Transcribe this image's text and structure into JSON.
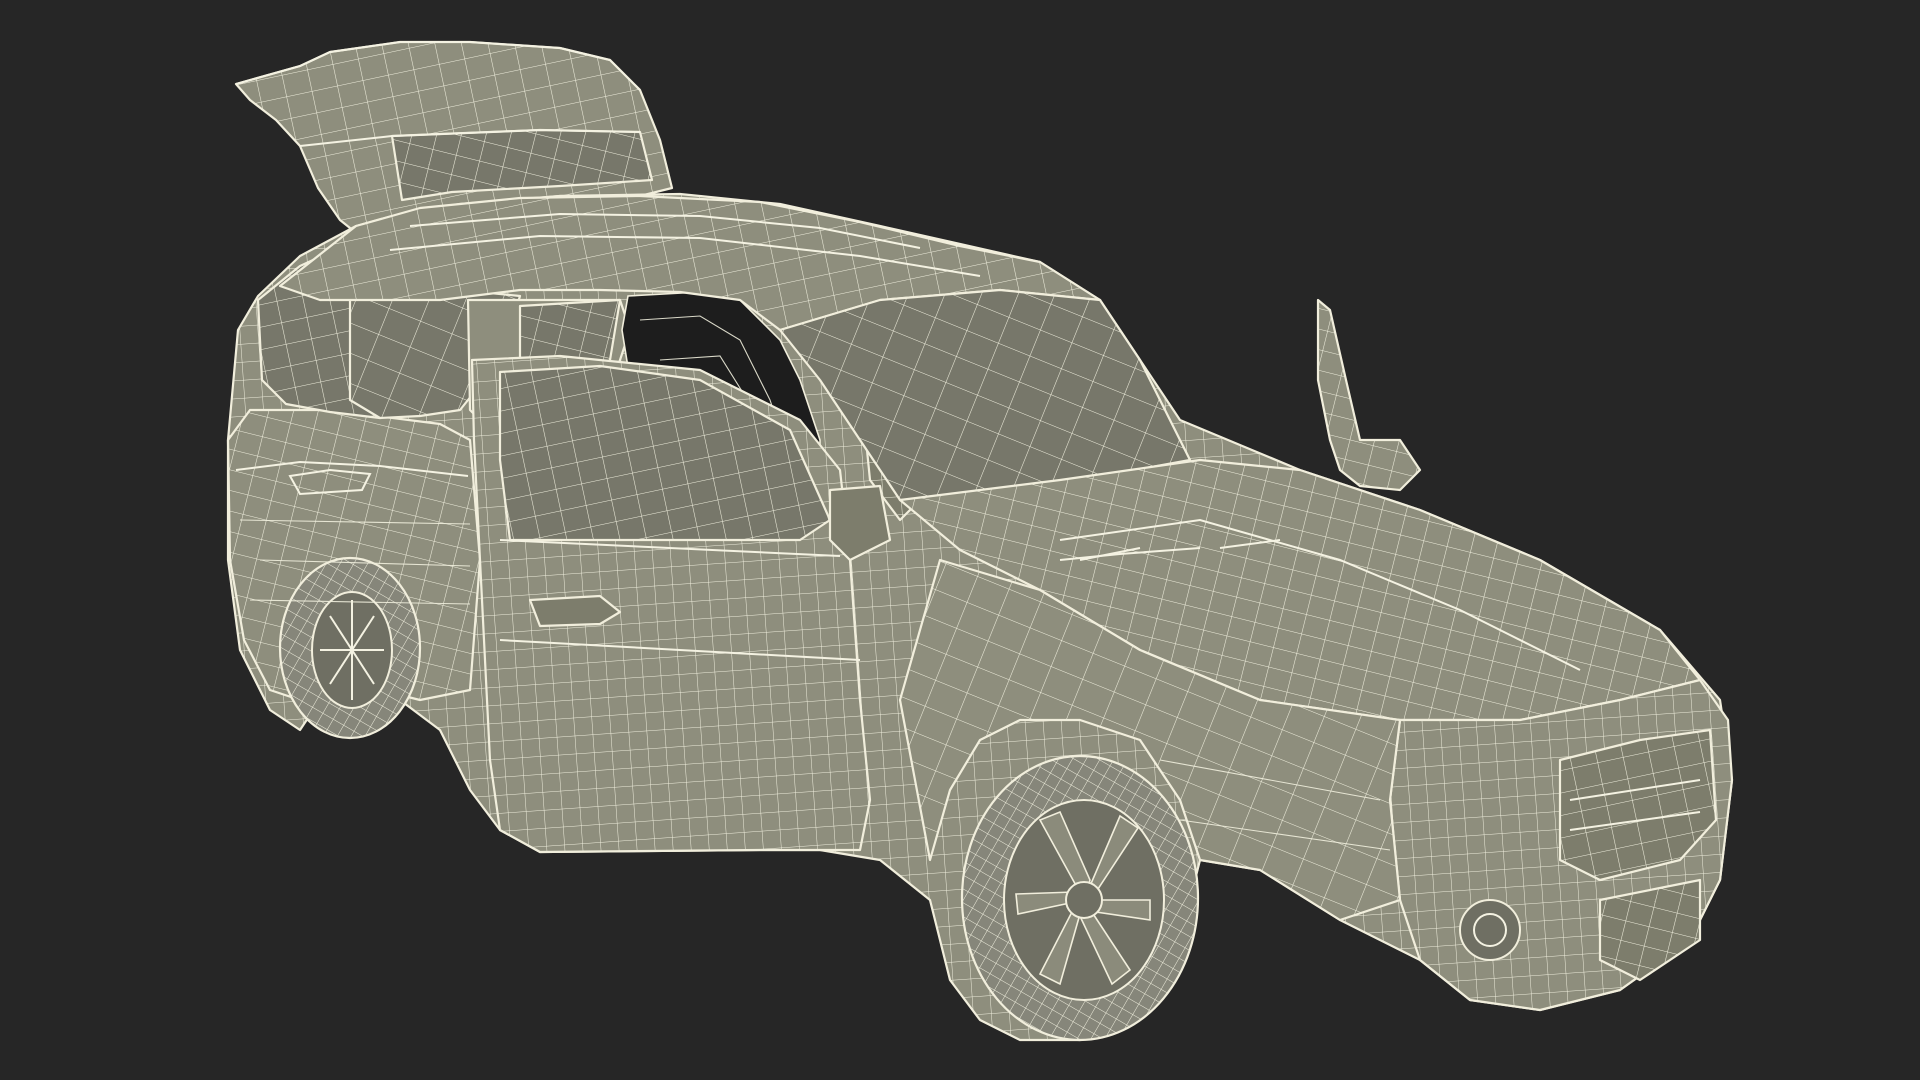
{
  "scene": {
    "subject": "wireframe-suv",
    "background_color": "#262626",
    "mesh_fill_color": "#8e8e7d",
    "wire_color": "#f1eedc",
    "doors_open": [
      "front-left-door",
      "rear-left-door",
      "tailgate"
    ],
    "mirror_folded_up": true
  }
}
